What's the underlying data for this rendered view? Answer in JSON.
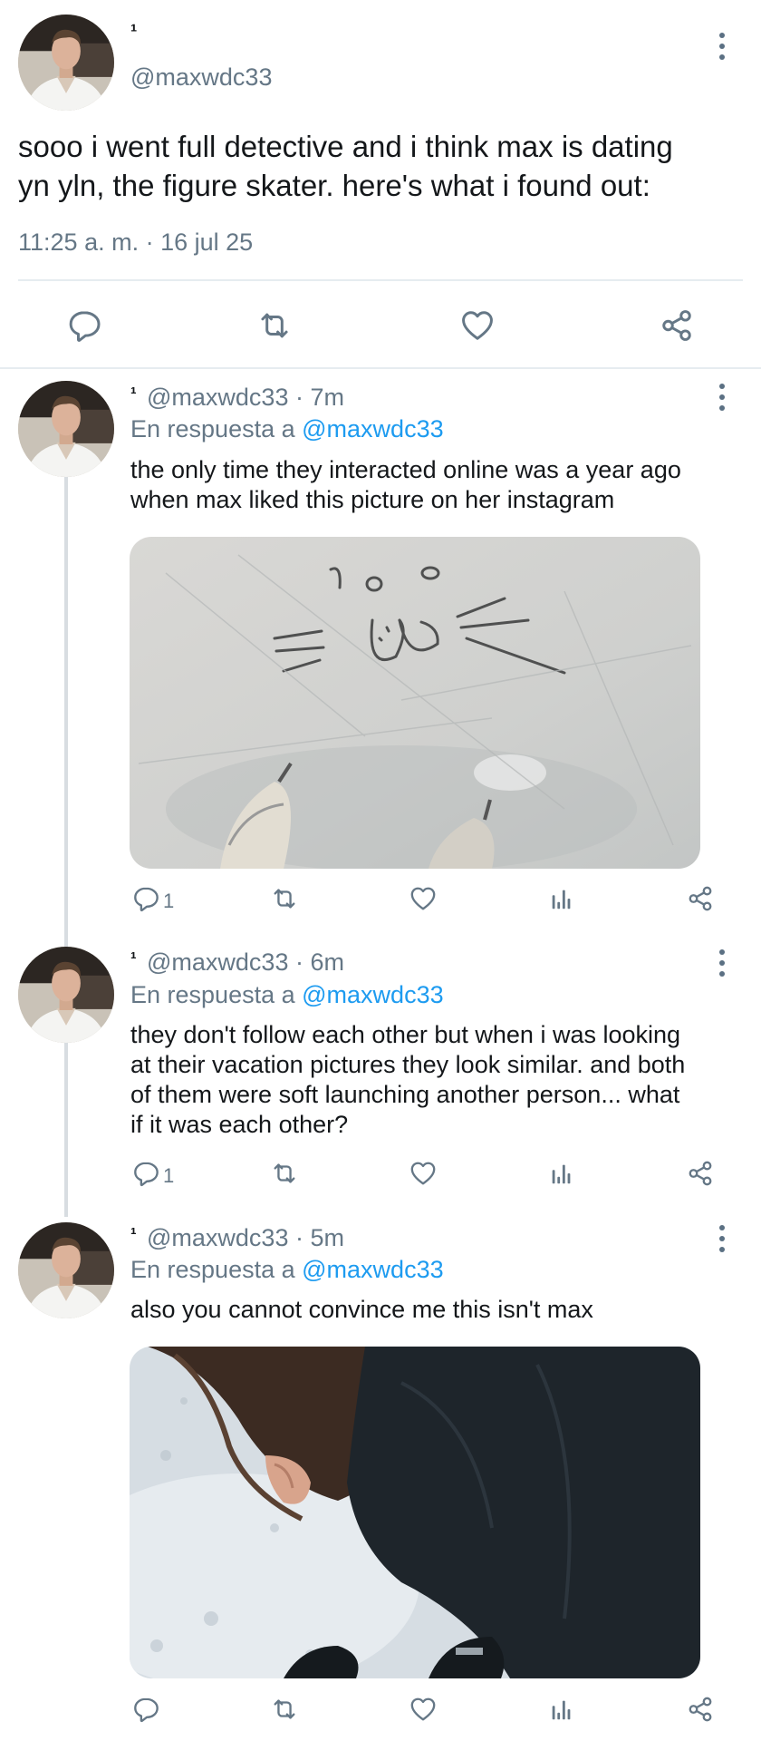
{
  "main_tweet": {
    "author_name": "¹",
    "handle": "@maxwdc33",
    "text": "sooo i went full detective and i think max is dating\nyn yln, the figure skater. here's what i found out:",
    "timestamp": "11:25 a. m. · 16 jul 25",
    "actions": [
      "reply-icon",
      "retweet-icon",
      "like-icon",
      "share-icon"
    ]
  },
  "replies": [
    {
      "author_name": "¹",
      "handle_time": "@maxwdc33 · 7m",
      "reply_prefix": "En respuesta a",
      "reply_to": "@maxwdc33",
      "text": "the only time they interacted online was a year ago\nwhen max liked this picture on her instagram",
      "media": "ice-drawing-photo",
      "reply_count": "1"
    },
    {
      "author_name": "¹",
      "handle_time": "@maxwdc33 · 6m",
      "reply_prefix": "En respuesta a",
      "reply_to": "@maxwdc33",
      "text": "they don't follow each other but when i was looking\nat their vacation pictures they look similar. and both\nof them were soft launching another person... what\nif it was each other?",
      "reply_count": "1"
    },
    {
      "author_name": "¹",
      "handle_time": "@maxwdc33 · 5m",
      "reply_prefix": "En respuesta a",
      "reply_to": "@maxwdc33",
      "text": "also you cannot convince me this isn't max",
      "media": "snow-person-photo",
      "reply_count": ""
    }
  ],
  "colors": {
    "text": "#14171a",
    "muted": "#657786",
    "link": "#1d9bf0",
    "divider": "#e6ecf0"
  }
}
